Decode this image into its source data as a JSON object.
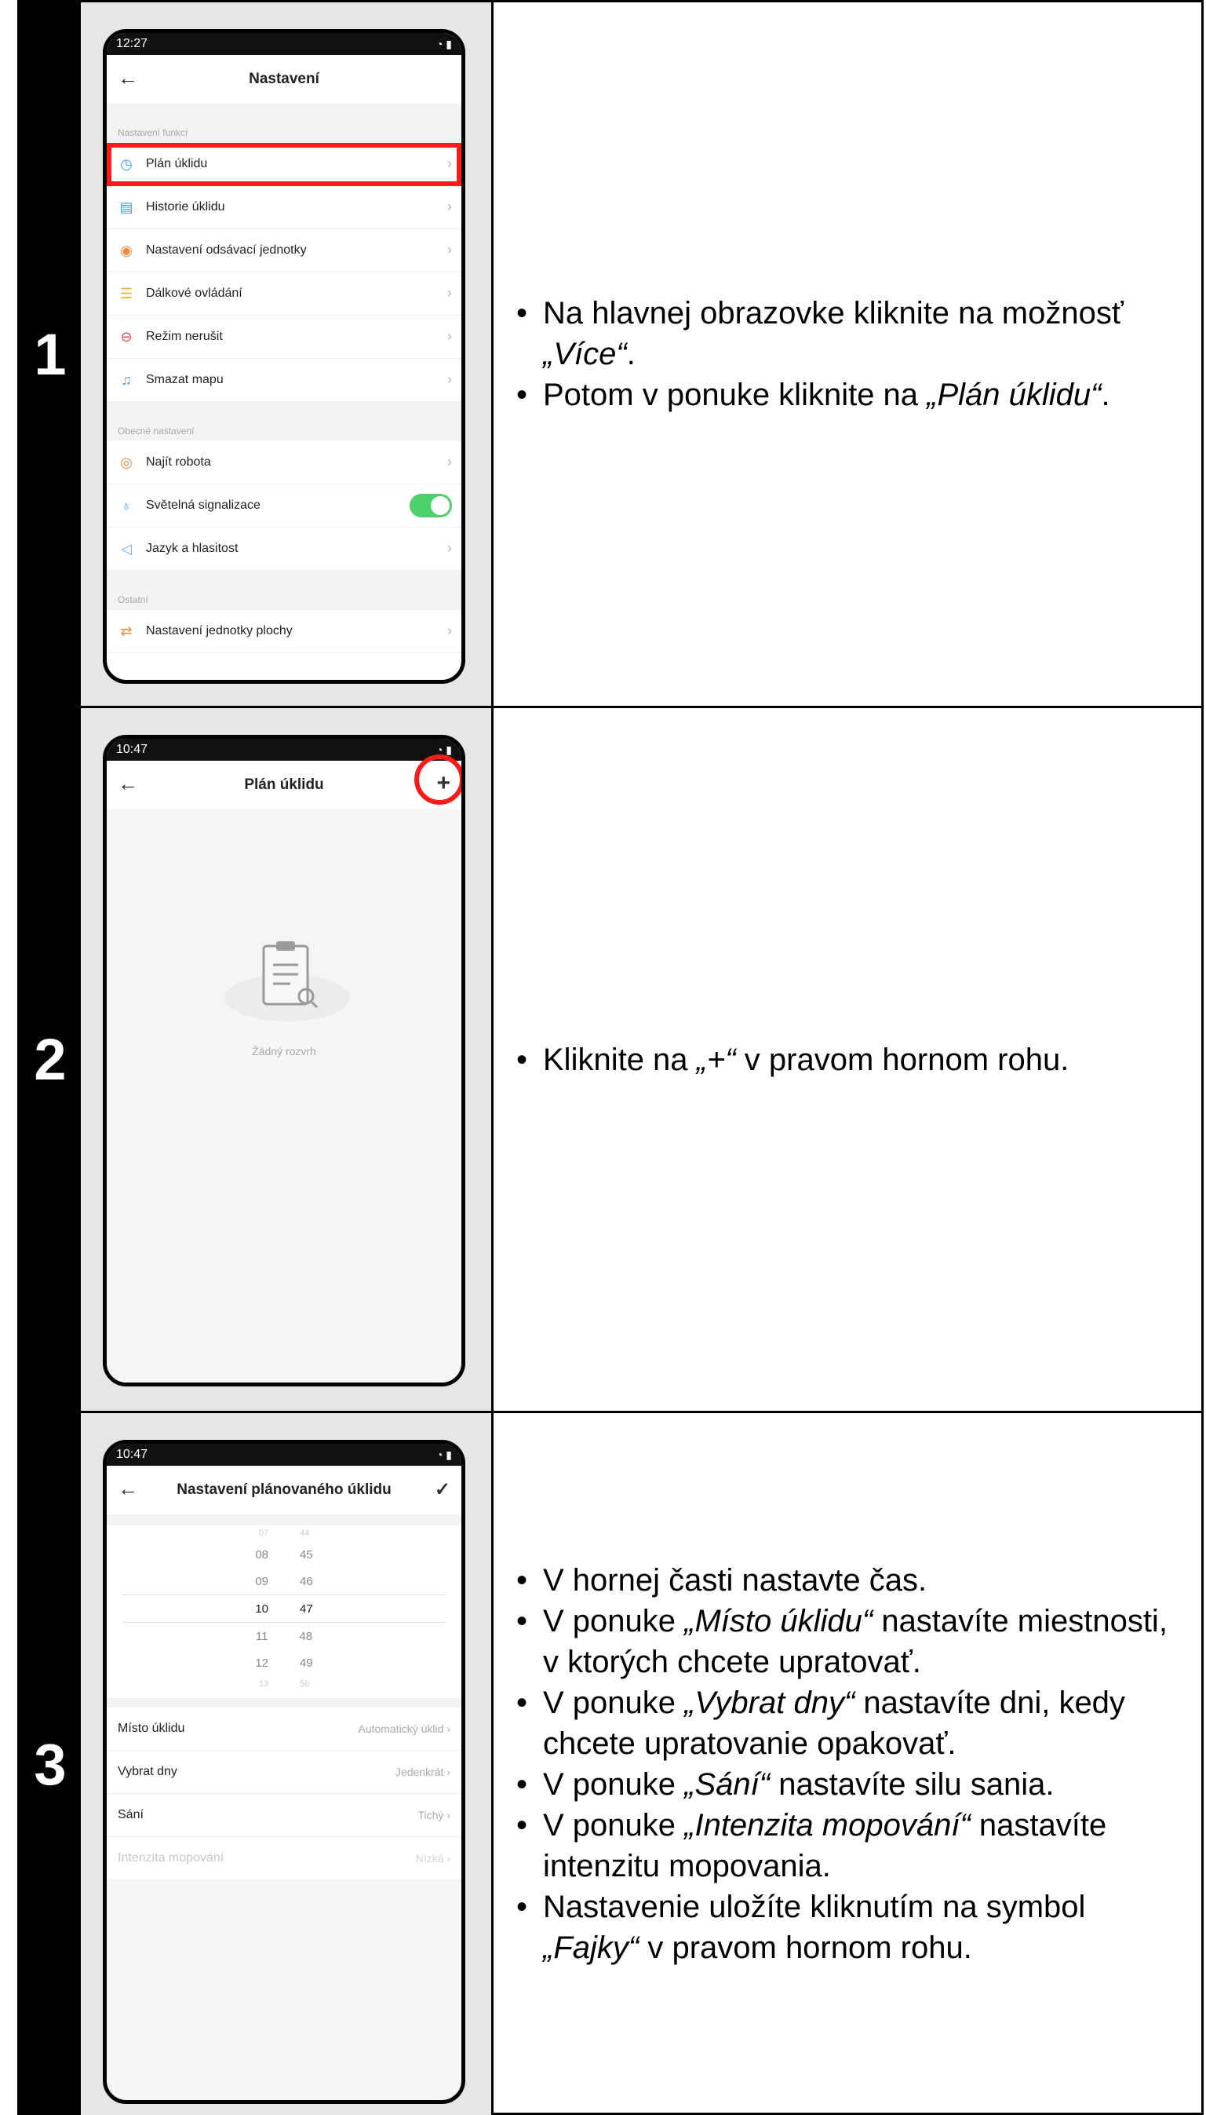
{
  "steps": [
    {
      "number": "1",
      "phone": {
        "time": "12:27",
        "title": "Nastavení",
        "section1": "Nastavení funkcí",
        "items1": [
          "Plán úklidu",
          "Historie úklidu",
          "Nastavení odsávací jednotky",
          "Dálkové ovládání",
          "Režim nerušit",
          "Smazat mapu"
        ],
        "section2": "Obecné nastavení",
        "items2": [
          "Najít robota",
          "Světelná signalizace",
          "Jazyk a hlasitost"
        ],
        "section3": "Ostatní",
        "items3": [
          "Nastavení jednotky plochy"
        ]
      },
      "bullets": [
        {
          "pre": "Na hlavnej obrazovke kliknite na možnosť ",
          "em": "„Více“",
          "post": "."
        },
        {
          "pre": "Potom v ponuke kliknite na ",
          "em": "„Plán úklidu“",
          "post": "."
        }
      ]
    },
    {
      "number": "2",
      "phone": {
        "time": "10:47",
        "title": "Plán úklidu",
        "plus": "+",
        "empty": "Žádný rozvrh"
      },
      "bullets": [
        {
          "pre": "Kliknite na ",
          "em": "„+“",
          "post": " v pravom hornom rohu."
        }
      ]
    },
    {
      "number": "3",
      "phone": {
        "time": "10:47",
        "title": "Nastavení plánovaného úklidu",
        "check": "✓",
        "hours": [
          "07",
          "08",
          "09",
          "10",
          "11",
          "12",
          "13"
        ],
        "minutes": [
          "44",
          "45",
          "46",
          "47",
          "48",
          "49",
          "50"
        ],
        "rows": [
          {
            "label": "Místo úklidu",
            "value": "Automatický úklid"
          },
          {
            "label": "Vybrat dny",
            "value": "Jedenkrát"
          },
          {
            "label": "Sání",
            "value": "Tichý"
          },
          {
            "label": "Intenzita mopování",
            "value": "Nízká"
          }
        ]
      },
      "bullets": [
        {
          "pre": "V hornej časti nastavte čas.",
          "em": "",
          "post": ""
        },
        {
          "pre": "V ponuke ",
          "em": "„Místo úklidu“",
          "post": " nastavíte miestnosti, v ktorých chcete upratovať."
        },
        {
          "pre": "V ponuke ",
          "em": "„Vybrat dny“",
          "post": " nastavíte dni, kedy chcete upratovanie opakovať."
        },
        {
          "pre": "V ponuke ",
          "em": "„Sání“",
          "post": " nastavíte silu sania."
        },
        {
          "pre": "V ponuke ",
          "em": "„Intenzita mopování“",
          "post": " nastavíte intenzitu mopovania."
        },
        {
          "pre": "Nastavenie uložíte kliknutím na symbol ",
          "em": "„Fajky“",
          "post": " v pravom hornom rohu."
        }
      ]
    }
  ]
}
